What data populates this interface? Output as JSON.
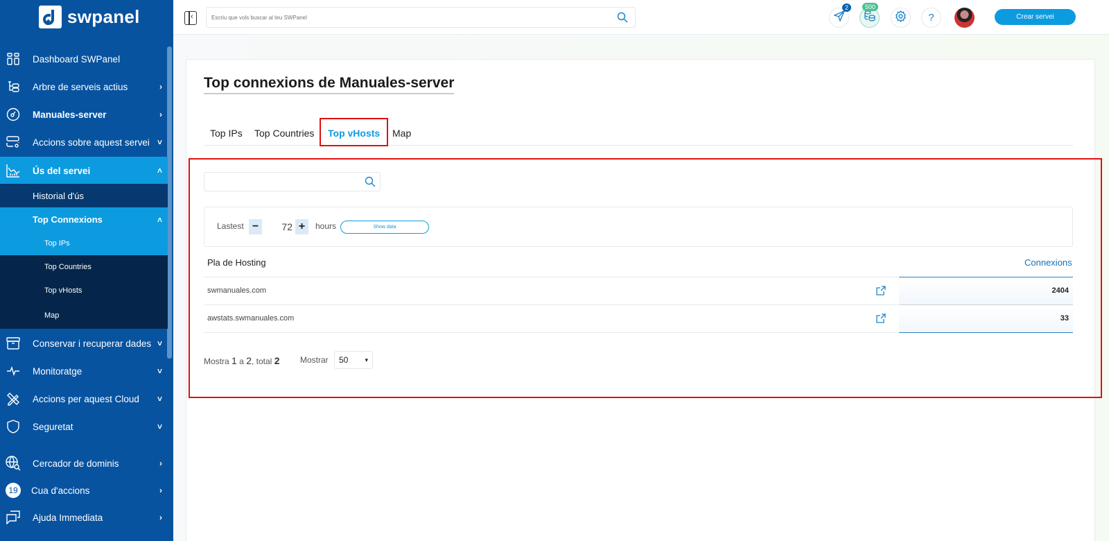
{
  "app": {
    "logo_text": "swpanel"
  },
  "sidebar": {
    "items": [
      {
        "label": "Dashboard SWPanel",
        "icon": "dashboard-grid-icon",
        "chevron": ""
      },
      {
        "label": "Arbre de serveis actius",
        "icon": "tree-icon",
        "chevron": "›"
      },
      {
        "label": "Manuales-server",
        "icon": "server-gauge-icon",
        "chevron": "›"
      },
      {
        "label": "Accions sobre aquest servei",
        "icon": "server-settings-icon",
        "chevron": "˅"
      },
      {
        "label": "Ús del servei",
        "icon": "chart-icon",
        "chevron": "˄"
      },
      {
        "label": "Historial d'ús"
      },
      {
        "label": "Top Connexions",
        "chevron": "˄"
      },
      {
        "label": "Top IPs"
      },
      {
        "label": "Top Countries"
      },
      {
        "label": "Top vHosts"
      },
      {
        "label": "Map"
      },
      {
        "label": "Conservar i recuperar dades",
        "icon": "archive-icon",
        "chevron": "˅"
      },
      {
        "label": "Monitoratge",
        "icon": "pulse-icon",
        "chevron": "˅"
      },
      {
        "label": "Accions per aquest Cloud",
        "icon": "tools-icon",
        "chevron": "˅"
      },
      {
        "label": "Seguretat",
        "icon": "shield-icon",
        "chevron": "˅"
      },
      {
        "label": "Cercador de dominis",
        "icon": "globe-search-icon",
        "chevron": "›"
      },
      {
        "label": "Cua d'accions",
        "badge": "19",
        "chevron": "›"
      },
      {
        "label": "Ajuda Immediata",
        "icon": "chat-icon",
        "chevron": "›"
      }
    ]
  },
  "topbar": {
    "search_placeholder": "Escriu que vols buscar al teu SWPanel",
    "notifications_count": "2",
    "credits_count": "500",
    "create_button": "Crear servei",
    "help_label": "?"
  },
  "page": {
    "title": "Top connexions de Manuales-server",
    "tabs": [
      {
        "label": "Top IPs",
        "active": false
      },
      {
        "label": "Top Countries",
        "active": false
      },
      {
        "label": "Top vHosts",
        "active": true
      },
      {
        "label": "Map",
        "active": false
      }
    ],
    "filter": {
      "value": ""
    },
    "hours_filter": {
      "prefix": "Lastest",
      "minus": "−",
      "value": "72",
      "plus": "+",
      "suffix": "hours",
      "button": "Show data"
    },
    "table": {
      "columns": [
        "Pla de Hosting",
        "Connexions"
      ],
      "rows": [
        {
          "host": "swmanuales.com",
          "connections": "2404"
        },
        {
          "host": "awstats.swmanuales.com",
          "connections": "33"
        }
      ]
    },
    "pagination": {
      "prefix": "Mostra",
      "from": "1",
      "mid": "a",
      "to": "2",
      "total_label": ", total",
      "total": "2",
      "show_label": "Mostrar",
      "page_size": "50"
    }
  },
  "colors": {
    "sidebar": "#0753a0",
    "accent": "#0d9be0",
    "highlight": "#e01010"
  }
}
